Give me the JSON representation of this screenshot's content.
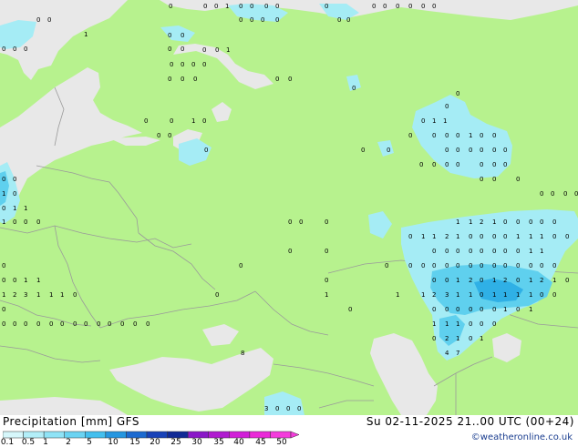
{
  "header": {
    "title": "Precipitation [mm] GFS",
    "time": "Su 02-11-2025 21..00 UTC (00+24)",
    "credit": "©weatheronline.co.uk"
  },
  "colors": {
    "land": "#b7f28e",
    "sea": "#e8e8e8",
    "border": "#9a9a9a",
    "precip_light": "#a5ecf5",
    "precip_medium": "#5fd0ee"
  },
  "legend": {
    "labels": [
      "0.1",
      "0.5",
      "1",
      "2",
      "5",
      "10",
      "15",
      "20",
      "25",
      "30",
      "35",
      "40",
      "45",
      "50"
    ],
    "colors": [
      "#d6f7fb",
      "#b2eef8",
      "#8fe3f6",
      "#6ad3f2",
      "#43bfee",
      "#2596e0",
      "#1c6ad0",
      "#1842b8",
      "#112a95",
      "#8a18c8",
      "#b01bd0",
      "#d11fd8",
      "#ea2ad8",
      "#f43cdc"
    ]
  },
  "values": [
    "0",
    "0",
    "1",
    "0",
    "0",
    "0",
    "1",
    "0",
    "0",
    "0",
    "0",
    "0",
    "0",
    "0",
    "0",
    "0",
    "0",
    "0",
    "0",
    "0",
    "0",
    "0",
    "0",
    "0",
    "0",
    "0",
    "0",
    "0",
    "0",
    "0",
    "0",
    "0",
    "0",
    "1",
    "0",
    "0",
    "0",
    "0",
    "0",
    "0",
    "0",
    "0",
    "0",
    "0",
    "0",
    "0",
    "0",
    "0",
    "1",
    "0",
    "0",
    "0",
    "0",
    "0",
    "0",
    "0",
    "0",
    "1",
    "1",
    "0",
    "0",
    "0",
    "1",
    "0",
    "0",
    "0",
    "0",
    "0",
    "0",
    "0",
    "0",
    "0",
    "0",
    "0",
    "0",
    "0",
    "0",
    "0",
    "0",
    "0",
    "0",
    "0",
    "0",
    "0",
    "0",
    "0",
    "0",
    "1",
    "0",
    "0",
    "1",
    "1",
    "1",
    "0",
    "0",
    "0",
    "0",
    "0",
    "0",
    "1",
    "1",
    "2",
    "1",
    "0",
    "0",
    "0",
    "0",
    "0",
    "0",
    "1",
    "1",
    "2",
    "1",
    "0",
    "0",
    "0",
    "0",
    "1",
    "1",
    "1",
    "0",
    "0",
    "0",
    "0",
    "0",
    "0",
    "0",
    "0",
    "0",
    "0",
    "0",
    "0",
    "1",
    "1",
    "0",
    "0",
    "0",
    "0",
    "0",
    "0",
    "0",
    "0",
    "0",
    "0",
    "0",
    "0",
    "0",
    "0",
    "0",
    "0",
    "0",
    "0",
    "1",
    "2",
    "0",
    "1",
    "2",
    "0",
    "1",
    "2",
    "1",
    "0",
    "0",
    "1",
    "1",
    "1",
    "2",
    "3",
    "1",
    "1",
    "0",
    "1",
    "1",
    "1",
    "1",
    "0",
    "0",
    "0",
    "0",
    "0",
    "0",
    "0",
    "0",
    "0",
    "1",
    "0",
    "1",
    "1",
    "1",
    "1",
    "0",
    "0",
    "0",
    "0",
    "0",
    "2",
    "1",
    "0",
    "1",
    "4",
    "7",
    "8",
    "3",
    "0",
    "0",
    "0",
    "0",
    "0",
    "0",
    "1",
    "1",
    "1",
    "2",
    "3",
    "1",
    "1",
    "1",
    "0",
    "0",
    "0",
    "0",
    "0",
    "0",
    "0",
    "0",
    "0",
    "0",
    "0",
    "0",
    "0",
    "0",
    "0",
    "0",
    "0",
    "0",
    "0",
    "0",
    "0",
    "0",
    "0",
    "0",
    "0",
    "1",
    "2",
    "0",
    "0",
    "1",
    "2",
    "0",
    "1",
    "0",
    "0",
    "0",
    "0"
  ]
}
